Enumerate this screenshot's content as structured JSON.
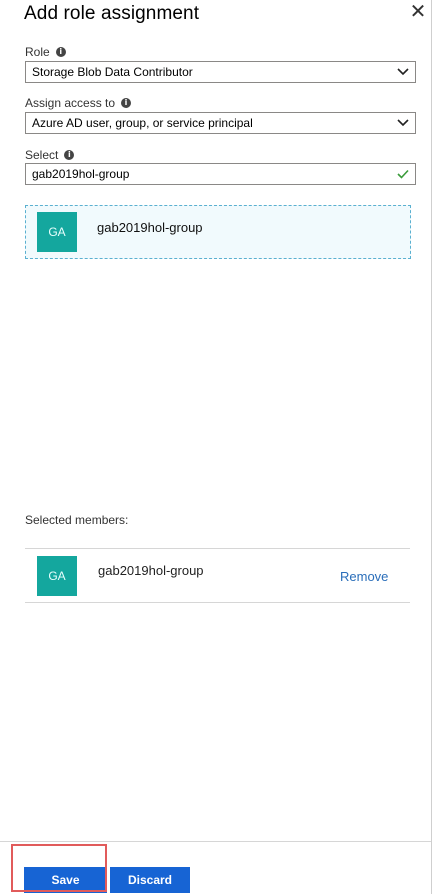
{
  "panel": {
    "title": "Add role assignment"
  },
  "role": {
    "label": "Role",
    "value": "Storage Blob Data Contributor"
  },
  "assign_access": {
    "label": "Assign access to",
    "value": "Azure AD user, group, or service principal"
  },
  "select": {
    "label": "Select",
    "value": "gab2019hol-group"
  },
  "picker_result": {
    "initials": "GA",
    "name": "gab2019hol-group"
  },
  "selected_members": {
    "label": "Selected members:",
    "items": [
      {
        "initials": "GA",
        "name": "gab2019hol-group",
        "remove_label": "Remove"
      }
    ]
  },
  "footer": {
    "save_label": "Save",
    "discard_label": "Discard"
  },
  "colors": {
    "avatar": "#14a79e",
    "primary_button": "#1764d4",
    "link": "#2a6eba",
    "check": "#3a9b3a"
  }
}
